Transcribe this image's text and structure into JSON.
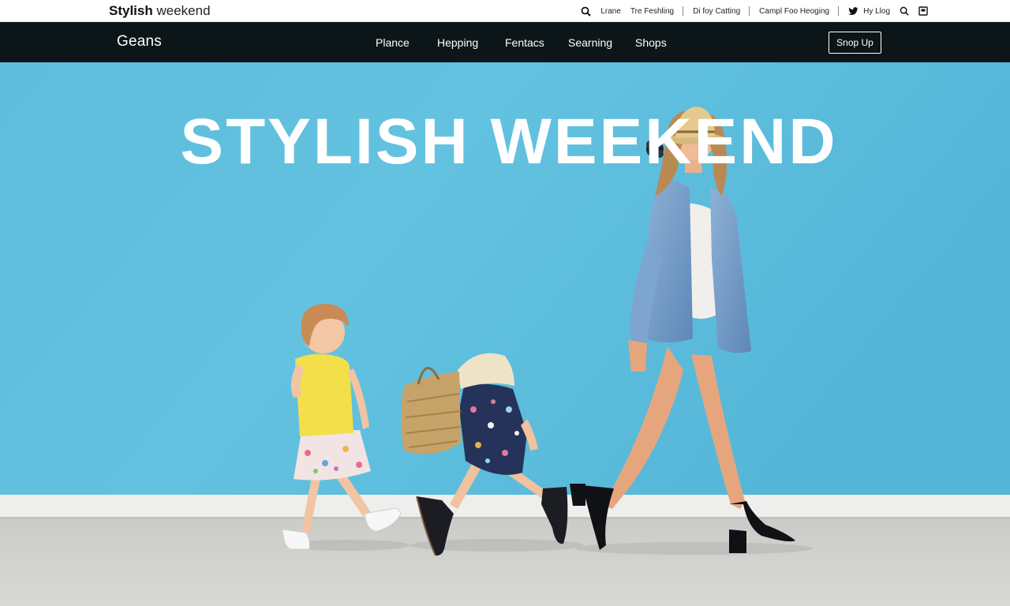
{
  "brand": {
    "strong": "Stylish",
    "light": "weekend"
  },
  "utility_links": {
    "link_1": "Lrane",
    "link_2": "Tre Feshling",
    "link_3": "Di foy Catting",
    "link_4": "Campl Foo Heoging",
    "link_5": "Hy Llog"
  },
  "icons": [
    "search-icon",
    "twitter-icon",
    "search-icon",
    "bag-icon"
  ],
  "nav": {
    "logo": "Geans",
    "items": [
      "Plance",
      "Hepping",
      "Fentacs",
      "Searning",
      "Shops"
    ],
    "cta": "Snop Up"
  },
  "hero": {
    "title": "STYLISH WEEKEND",
    "scene": "Mother walking with two children past a sky-blue wall"
  },
  "colors": {
    "nav_background": "#0c1619",
    "hero_wall": "#62c0df",
    "pavement": "#cfcfcc",
    "text_on_dark": "#ffffff"
  }
}
